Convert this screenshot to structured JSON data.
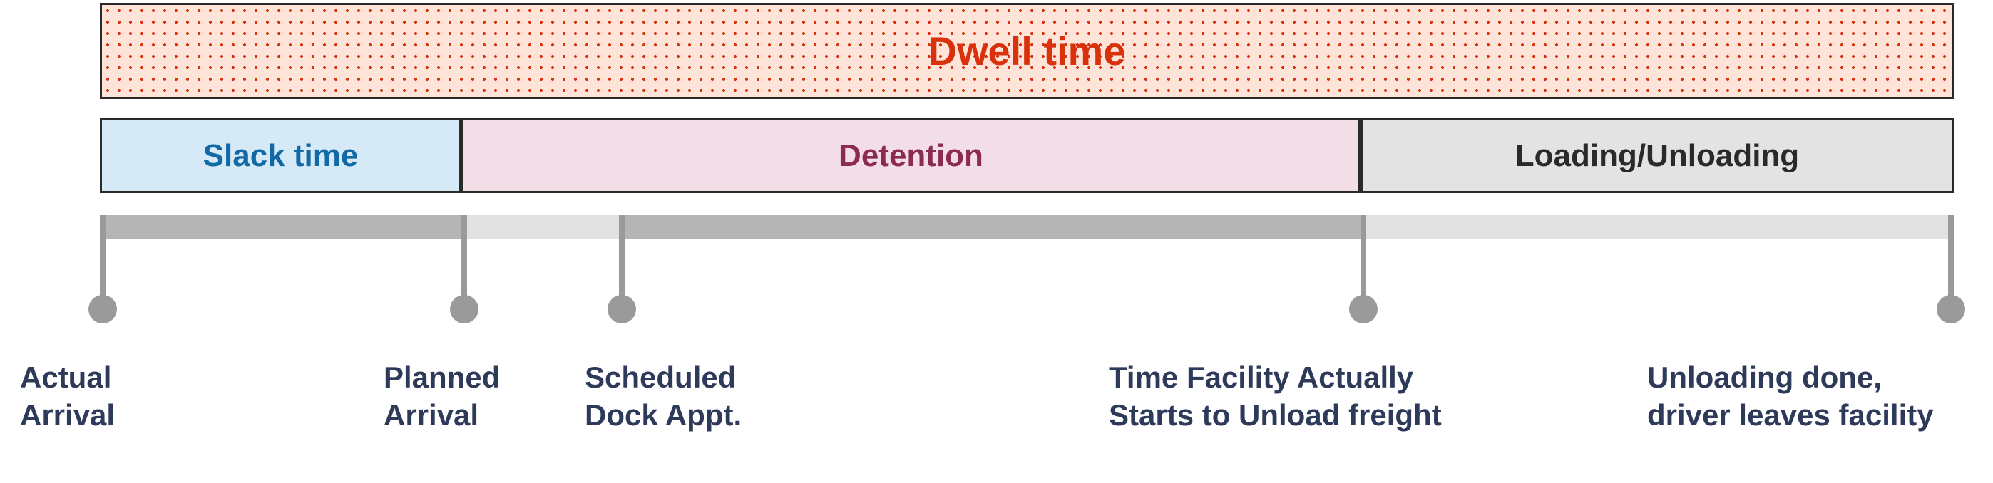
{
  "chart_data": {
    "type": "bar",
    "title": "",
    "xlabel": "",
    "ylabel": "",
    "spans": {
      "dwell": {
        "label": "Dwell time",
        "start": 0,
        "end": 100
      },
      "segments": [
        {
          "key": "slack",
          "label": "Slack time",
          "start": 0,
          "end": 19.5
        },
        {
          "key": "detention",
          "label": "Detention",
          "start": 19.5,
          "end": 68
        },
        {
          "key": "loading",
          "label": "Loading/Unloading",
          "start": 68,
          "end": 100
        }
      ]
    },
    "ticks": [
      {
        "key": "actual_arrival",
        "label": "Actual\nArrival",
        "pos": 0
      },
      {
        "key": "planned_arrival",
        "label": "Planned\nArrival",
        "pos": 19.5
      },
      {
        "key": "scheduled_dock",
        "label": "Scheduled\nDock Appt.",
        "pos": 28
      },
      {
        "key": "facility_starts",
        "label": "Time Facility Actually\nStarts to Unload freight",
        "pos": 68
      },
      {
        "key": "unloading_done",
        "label": "Unloading done,\ndriver leaves facility",
        "pos": 100
      }
    ],
    "axis_shaded": [
      {
        "start": 0,
        "end": 19.5
      },
      {
        "start": 28,
        "end": 68
      }
    ]
  }
}
